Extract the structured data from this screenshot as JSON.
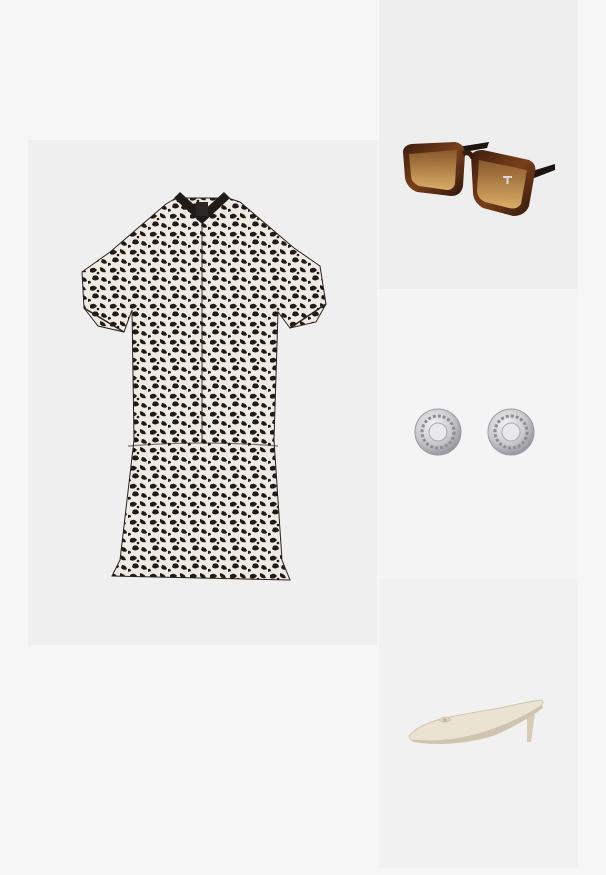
{
  "outfit": {
    "items": [
      {
        "name": "dress",
        "icon": "leopard-print-tiered-shirt-dress"
      },
      {
        "name": "sunglasses",
        "icon": "tortoiseshell-square-sunglasses"
      },
      {
        "name": "earrings",
        "icon": "silver-logo-stud-earrings"
      },
      {
        "name": "shoes",
        "icon": "cream-pointed-kitten-heel-mules"
      }
    ],
    "colors": {
      "page_background": "#f6f6f6",
      "print_dark": "#1f1b18",
      "print_light": "#efeae2",
      "tortoise": "#5a2e14",
      "lens_gradient_top": "#8a5a2e",
      "lens_gradient_bottom": "#e0b36a",
      "silver": "#c9c9cc",
      "mule_cream": "#ebe3d2"
    }
  }
}
